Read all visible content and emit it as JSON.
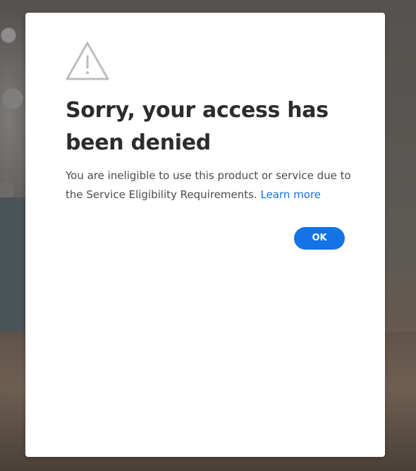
{
  "dialog": {
    "icon": "alert-triangle-icon",
    "title": "Sorry, your access has been denied",
    "message": "You are ineligible to use this product or service due to the Service Eligibility Requirements.",
    "learn_more_label": "Learn more",
    "ok_label": "OK"
  },
  "colors": {
    "accent": "#1473e6",
    "title_text": "#2c2c2c",
    "body_text": "#4b4b4b",
    "icon_stroke": "#bdbdbd"
  }
}
